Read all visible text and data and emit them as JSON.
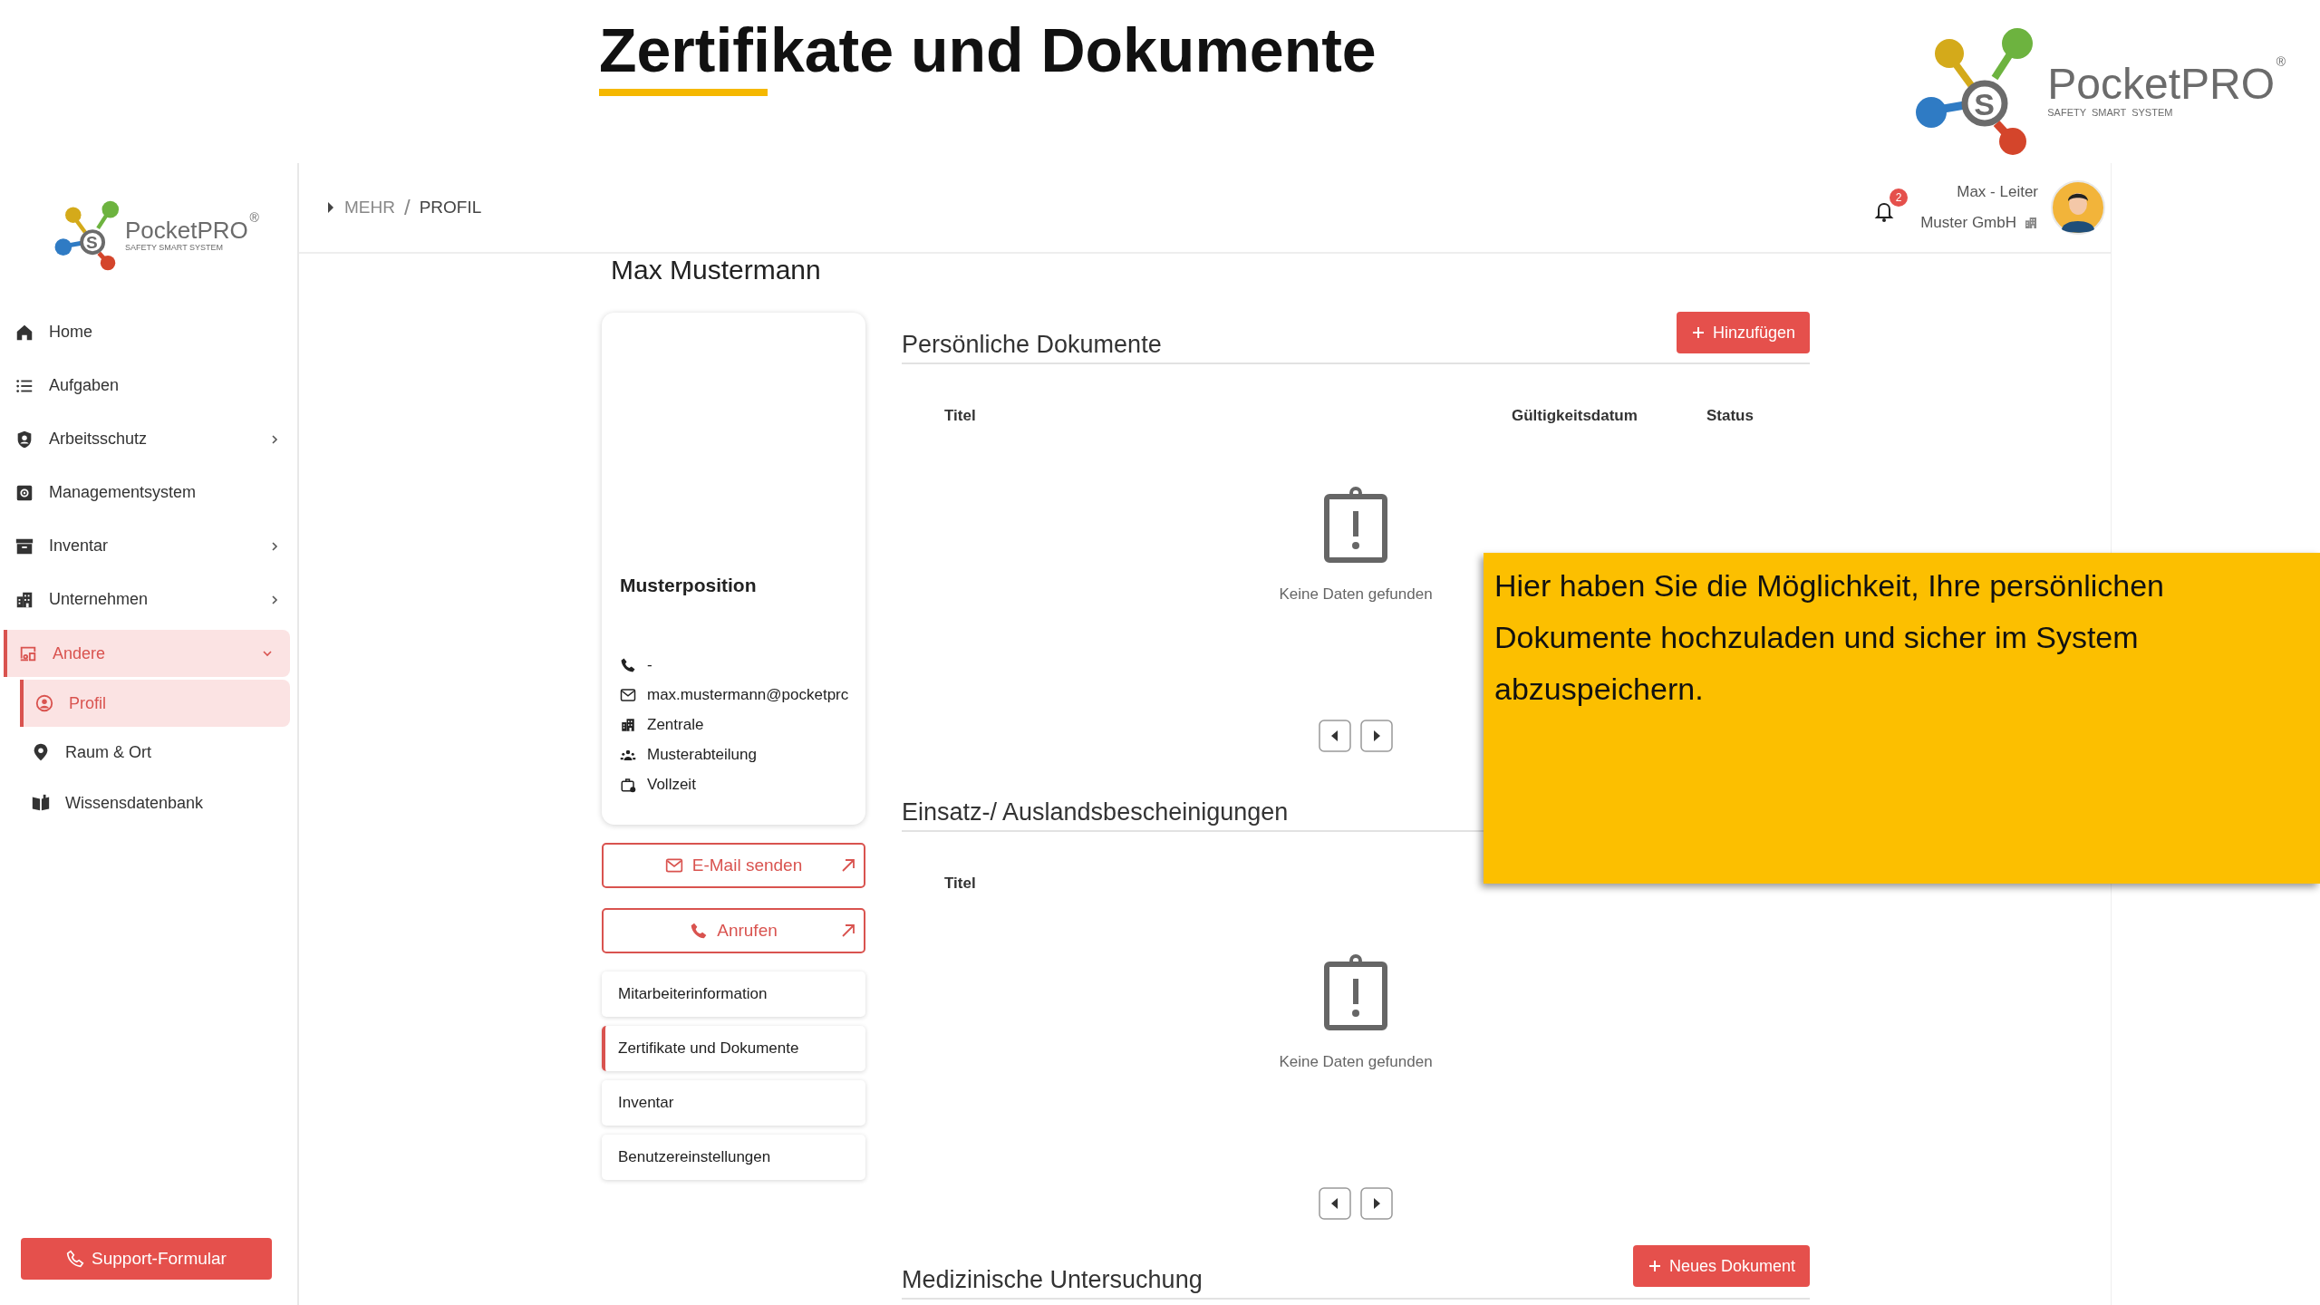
{
  "slide": {
    "title": "Zertifikate und Dokumente",
    "logo": {
      "mark": "S",
      "name": "PocketPRO",
      "reg": "®",
      "tagline": "SAFETY  SMART  SYSTEM"
    }
  },
  "sidebar": {
    "logo": {
      "mark": "S",
      "name": "PocketPRO",
      "reg": "®",
      "tagline": "SAFETY SMART SYSTEM"
    },
    "items": [
      {
        "label": "Home",
        "selected": false
      },
      {
        "label": "Aufgaben",
        "selected": false
      },
      {
        "label": "Arbeitsschutz",
        "selected": false,
        "expanded": false
      },
      {
        "label": "Managementsystem",
        "selected": false
      },
      {
        "label": "Inventar",
        "selected": false,
        "expanded": false
      },
      {
        "label": "Unternehmen",
        "selected": false,
        "expanded": false
      },
      {
        "label": "Andere",
        "selected": true,
        "expanded": true,
        "children": [
          {
            "label": "Profil",
            "selected": true
          },
          {
            "label": "Raum & Ort",
            "selected": false
          },
          {
            "label": "Wissensdatenbank",
            "selected": false
          }
        ]
      }
    ],
    "support_button": "Support-Formular"
  },
  "topbar": {
    "breadcrumb": [
      "MEHR",
      "PROFIL"
    ],
    "separator": "/",
    "notifications": "2",
    "user": "Max - Leiter",
    "company": "Muster GmbH"
  },
  "profile": {
    "name": "Max Mustermann",
    "position": "Musterposition",
    "contacts": [
      "-",
      "max.mustermann@pocketprc",
      "Zentrale",
      "Musterabteilung",
      "Vollzeit"
    ],
    "buttons": [
      "E-Mail senden",
      "Anrufen"
    ],
    "menu": [
      {
        "label": "Mitarbeiterinformation",
        "selected": false
      },
      {
        "label": "Zertifikate und Dokumente",
        "selected": true
      },
      {
        "label": "Inventar",
        "selected": false
      },
      {
        "label": "Benutzereinstellungen",
        "selected": false
      }
    ]
  },
  "sections": [
    {
      "title": "Persönliche Dokumente",
      "button": "Hinzufügen",
      "columns": [
        "Titel",
        "Gültigkeitsdatum",
        "Status"
      ],
      "empty": "Keine Daten gefunden"
    },
    {
      "title": "Einsatz-/ Auslandsbescheinigungen",
      "columns": [
        "Titel"
      ],
      "empty": "Keine Daten gefunden"
    },
    {
      "title": "Medizinische Untersuchung",
      "button": "Neues Dokument"
    }
  ],
  "callout": "Hier haben Sie die Möglichkeit, Ihre persönlichen Dokumente hochzuladen und sicher im System abzuspeichern."
}
